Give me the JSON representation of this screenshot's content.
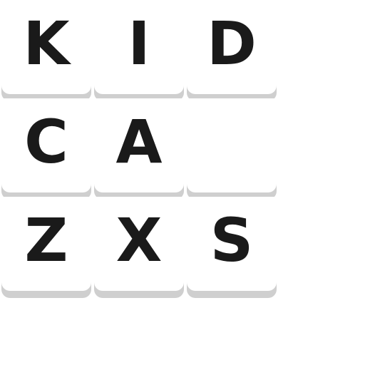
{
  "board": {
    "rows": [
      [
        "K",
        "I",
        "D"
      ],
      [
        "C",
        "A",
        ""
      ],
      [
        "Z",
        "X",
        "S"
      ]
    ]
  },
  "colors": {
    "tile_face": "#ffffff",
    "tile_shadow": "#cfcfcf",
    "letter": "#1a1a1a"
  }
}
